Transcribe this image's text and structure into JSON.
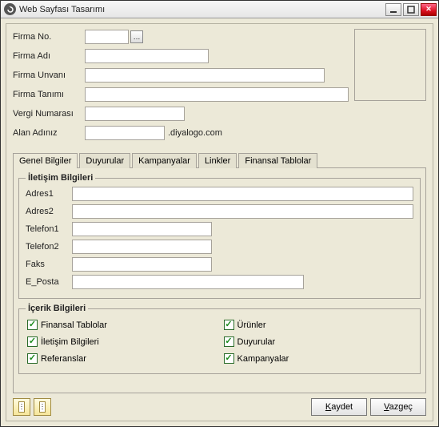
{
  "window": {
    "title": "Web Sayfası Tasarımı"
  },
  "form": {
    "firma_no_label": "Firma No.",
    "firma_no_value": "",
    "firma_adi_label": "Firma Adı",
    "firma_adi_value": "",
    "firma_unvani_label": "Firma Unvanı",
    "firma_unvani_value": "",
    "firma_tanimi_label": "Firma Tanımı",
    "firma_tanimi_value": "",
    "vergi_no_label": "Vergi Numarası",
    "vergi_no_value": "",
    "alan_adi_label": "Alan Adınız",
    "alan_adi_value": "",
    "alan_adi_suffix": ".diyalogo.com"
  },
  "tabs": {
    "t0": "Genel Bilgiler",
    "t1": "Duyurular",
    "t2": "Kampanyalar",
    "t3": "Linkler",
    "t4": "Finansal Tablolar"
  },
  "contact": {
    "legend": "İletişim Bilgileri",
    "adres1_label": "Adres1",
    "adres1_value": "",
    "adres2_label": "Adres2",
    "adres2_value": "",
    "tel1_label": "Telefon1",
    "tel1_value": "",
    "tel2_label": "Telefon2",
    "tel2_value": "",
    "faks_label": "Faks",
    "faks_value": "",
    "eposta_label": "E_Posta",
    "eposta_value": ""
  },
  "content": {
    "legend": "İçerik Bilgileri",
    "c0": "Finansal Tablolar",
    "c1": "Ürünler",
    "c2": "İletişim Bilgileri",
    "c3": "Duyurular",
    "c4": "Referanslar",
    "c5": "Kampanyalar"
  },
  "footer": {
    "kaydet_u": "K",
    "kaydet_rest": "aydet",
    "vazgec_u": "V",
    "vazgec_rest": "azgeç"
  }
}
